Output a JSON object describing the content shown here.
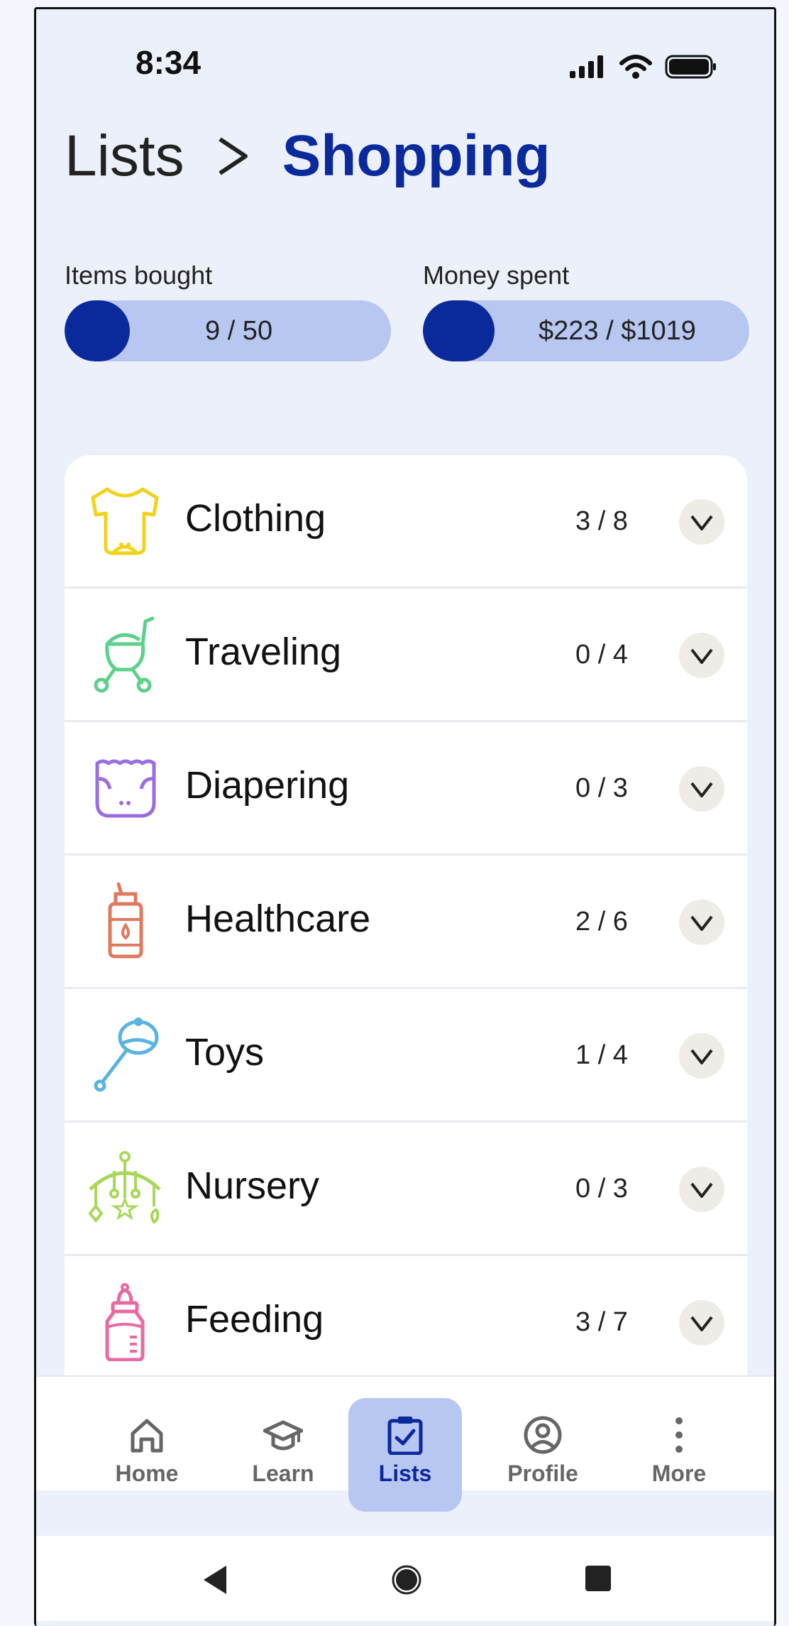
{
  "status": {
    "time": "8:34"
  },
  "breadcrumb": {
    "parent": "Lists",
    "current": "Shopping"
  },
  "stats": {
    "items": {
      "label": "Items bought",
      "value_text": "9 / 50",
      "bought": 9,
      "total": 50
    },
    "money": {
      "label": "Money spent",
      "value_text": "$223 / $1019",
      "spent": 223,
      "total": 1019
    }
  },
  "categories": [
    {
      "name": "Clothing",
      "count": "3 / 8",
      "icon": "onesie-icon",
      "color": "#f2d21b"
    },
    {
      "name": "Traveling",
      "count": "0 / 4",
      "icon": "stroller-icon",
      "color": "#5ed08c"
    },
    {
      "name": "Diapering",
      "count": "0 / 3",
      "icon": "diaper-icon",
      "color": "#9a6ee0"
    },
    {
      "name": "Healthcare",
      "count": "2 / 6",
      "icon": "bottle-medicine-icon",
      "color": "#e07a5f"
    },
    {
      "name": "Toys",
      "count": "1 / 4",
      "icon": "rattle-icon",
      "color": "#5ab4e0"
    },
    {
      "name": "Nursery",
      "count": "0 / 3",
      "icon": "crib-mobile-icon",
      "color": "#a8d85a"
    },
    {
      "name": "Feeding",
      "count": "3 / 7",
      "icon": "baby-bottle-icon",
      "color": "#e86aa2"
    }
  ],
  "nav": [
    {
      "label": "Home",
      "icon": "home-icon"
    },
    {
      "label": "Learn",
      "icon": "graduation-cap-icon"
    },
    {
      "label": "Lists",
      "icon": "clipboard-check-icon",
      "active": true
    },
    {
      "label": "Profile",
      "icon": "user-circle-icon"
    },
    {
      "label": "More",
      "icon": "more-vertical-icon"
    }
  ],
  "colors": {
    "accent": "#0a2a9c",
    "accent_light": "#b8c7f1",
    "background": "#ecf0fa"
  }
}
